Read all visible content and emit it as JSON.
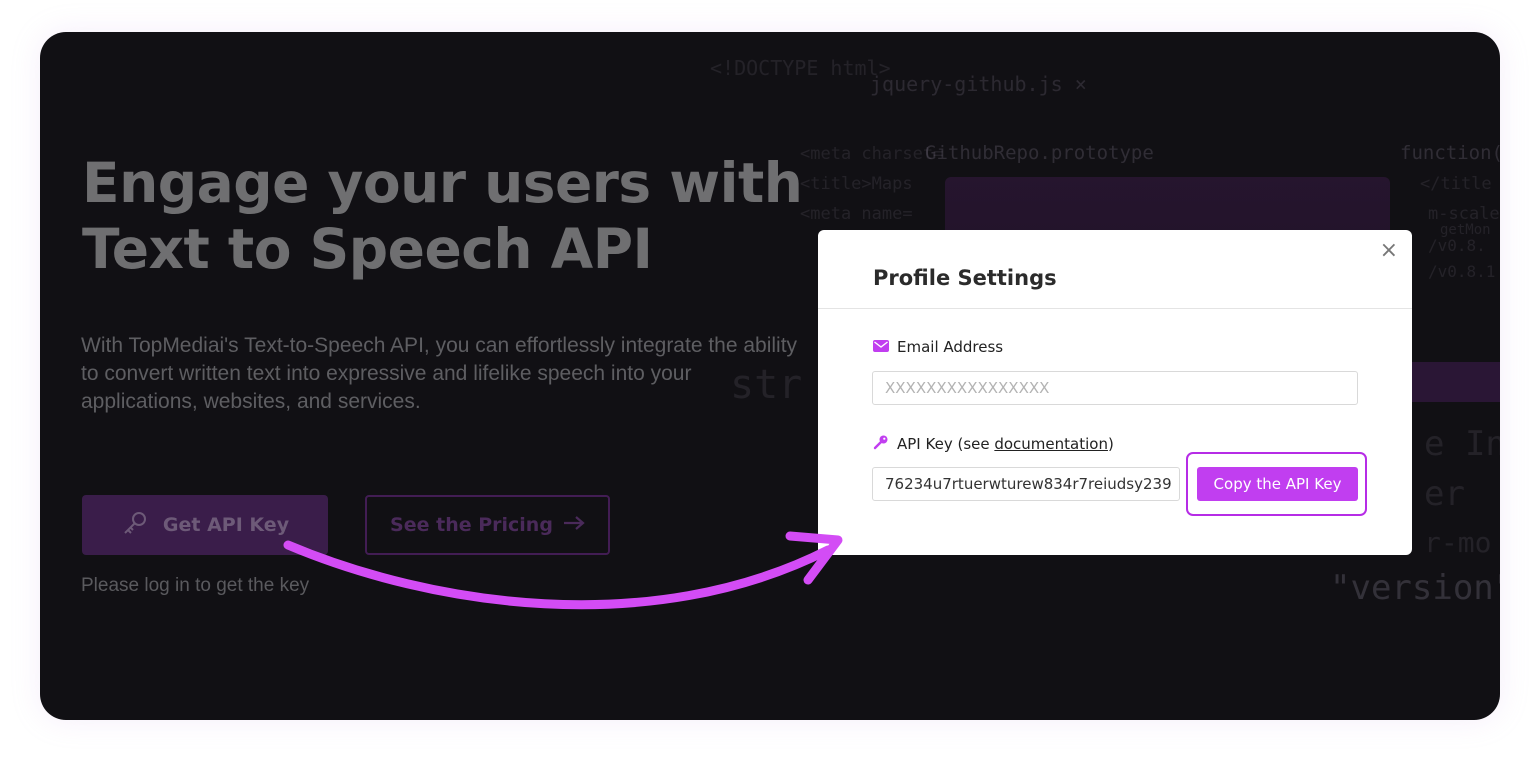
{
  "hero": {
    "headline_line1": "Engage your users with",
    "headline_line2": "Text to Speech API",
    "description": "With TopMediai's Text-to-Speech API, you can effortlessly integrate the ability to convert written text into expressive and lifelike speech into your applications, websites, and services.",
    "get_key_label": "Get API Key",
    "pricing_label": "See the Pricing",
    "login_note": "Please log in to get the key"
  },
  "code_background": [
    "<!DOCTYPE html>",
    "jquery-github.js ×",
    "<meta charset=",
    "GithubRepo.prototype",
    "function(",
    "<title>Maps",
    "</title",
    "<meta name=",
    "m-scale",
    "getMon",
    "/v0.8.",
    "/v0.8.1",
    "str",
    "e In",
    "er",
    "r-mo",
    "\"version\""
  ],
  "modal": {
    "title": "Profile Settings",
    "close_glyph": "×",
    "email_label": "Email Address",
    "email_value": "XXXXXXXXXXXXXXXX",
    "api_label_prefix": "API Key (see ",
    "api_label_link": "documentation",
    "api_label_suffix": ")",
    "api_key_value": "76234u7rtuerwturew834r7reiudsy239",
    "copy_button_label": "Copy the API Key"
  },
  "colors": {
    "accent": "#c13ef0",
    "accent_outline": "#b62ce6",
    "background": "#111014",
    "annotation_arrow": "#d34cf5"
  },
  "icons": [
    "key-icon",
    "arrow-right-icon",
    "mail-icon",
    "close-icon",
    "annotation-arrow"
  ]
}
